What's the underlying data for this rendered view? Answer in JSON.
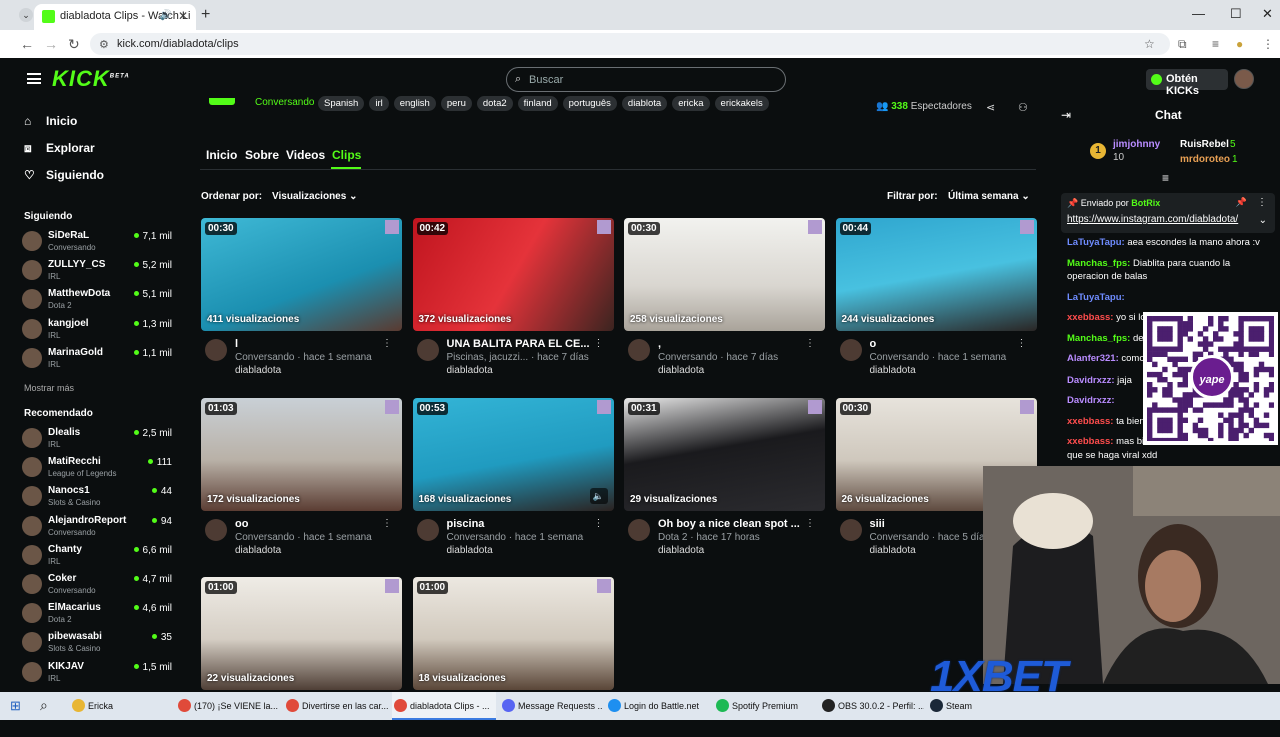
{
  "browser": {
    "tab_title": "diabladota Clips - Watch Li",
    "url": "kick.com/diabladota/clips"
  },
  "header": {
    "search_placeholder": "Buscar",
    "kicks_button": "Obtén KICKs"
  },
  "sidebar": {
    "nav": [
      {
        "label": "Inicio",
        "icon": "home-icon"
      },
      {
        "label": "Explorar",
        "icon": "compass-icon"
      },
      {
        "label": "Siguiendo",
        "icon": "heart-icon"
      }
    ],
    "following_title": "Siguiendo",
    "following": [
      {
        "name": "SiDeRaL",
        "category": "Conversando",
        "viewers": "7,1 mil"
      },
      {
        "name": "ZULLYY_CS",
        "category": "IRL",
        "viewers": "5,2 mil"
      },
      {
        "name": "MatthewDota",
        "category": "Dota 2",
        "viewers": "5,1 mil"
      },
      {
        "name": "kangjoel",
        "category": "IRL",
        "viewers": "1,3 mil"
      },
      {
        "name": "MarinaGold",
        "category": "IRL",
        "viewers": "1,1 mil"
      }
    ],
    "show_more": "Mostrar más",
    "recommended_title": "Recomendado",
    "recommended": [
      {
        "name": "Dlealis",
        "category": "IRL",
        "viewers": "2,5 mil"
      },
      {
        "name": "MatiRecchi",
        "category": "League of Legends",
        "viewers": "111"
      },
      {
        "name": "Nanocs1",
        "category": "Slots & Casino",
        "viewers": "44"
      },
      {
        "name": "AlejandroReport",
        "category": "Conversando",
        "viewers": "94"
      },
      {
        "name": "Chanty",
        "category": "IRL",
        "viewers": "6,6 mil"
      },
      {
        "name": "Coker",
        "category": "Conversando",
        "viewers": "4,7 mil"
      },
      {
        "name": "ElMacarius",
        "category": "Dota 2",
        "viewers": "4,6 mil"
      },
      {
        "name": "pibewasabi",
        "category": "Slots & Casino",
        "viewers": "35"
      },
      {
        "name": "KIKJAV",
        "category": "IRL",
        "viewers": "1,5 mil"
      }
    ]
  },
  "channel": {
    "category": "Conversando",
    "tags": [
      "Spanish",
      "irl",
      "english",
      "peru",
      "dota2",
      "finland",
      "português",
      "diablota",
      "ericka",
      "erickakels"
    ],
    "viewers_count": "338",
    "viewers_label": "Espectadores",
    "tabs": [
      "Inicio",
      "Sobre",
      "Videos",
      "Clips"
    ],
    "order_label": "Ordenar por:",
    "order_value": "Visualizaciones",
    "filter_label": "Filtrar por:",
    "filter_value": "Última semana"
  },
  "clips": [
    {
      "duration": "00:30",
      "views": "411 visualizaciones",
      "title": "l",
      "meta": "Conversando · hace 1 semana",
      "author": "diabladota"
    },
    {
      "duration": "00:42",
      "views": "372 visualizaciones",
      "title": "UNA BALITA PARA EL CE...",
      "meta": "Piscinas, jacuzzi... · hace 7 días",
      "author": "diabladota"
    },
    {
      "duration": "00:30",
      "views": "258 visualizaciones",
      "title": ",",
      "meta": "Conversando · hace 7 días",
      "author": "diabladota"
    },
    {
      "duration": "00:44",
      "views": "244 visualizaciones",
      "title": "o",
      "meta": "Conversando · hace 1 semana",
      "author": "diabladota"
    },
    {
      "duration": "01:03",
      "views": "172 visualizaciones",
      "title": "oo",
      "meta": "Conversando · hace 1 semana",
      "author": "diabladota"
    },
    {
      "duration": "00:53",
      "views": "168 visualizaciones",
      "title": "piscina",
      "meta": "Conversando · hace 1 semana",
      "author": "diabladota"
    },
    {
      "duration": "00:31",
      "views": "29 visualizaciones",
      "title": "Oh boy a nice clean spot ...",
      "meta": "Dota 2 · hace 17 horas",
      "author": "diabladota"
    },
    {
      "duration": "00:30",
      "views": "26 visualizaciones",
      "title": "siii",
      "meta": "Conversando · hace 5 días",
      "author": "diabladota"
    },
    {
      "duration": "01:00",
      "views": "22 visualizaciones",
      "title": "",
      "meta": "",
      "author": ""
    },
    {
      "duration": "01:00",
      "views": "18 visualizaciones",
      "title": "",
      "meta": "",
      "author": ""
    }
  ],
  "chat": {
    "title": "Chat",
    "leaderboard": [
      {
        "name": "jimjohnny",
        "value": "10"
      },
      {
        "name": "RuisRebel",
        "value": "5"
      },
      {
        "name": "mrdoroteo",
        "value": "1"
      }
    ],
    "pinned_by_label": "Enviado por",
    "pinned_by_user": "BotRix",
    "pinned_link": "https://www.instagram.com/diabladota/",
    "messages": [
      {
        "user": "LaTuyaTapu:",
        "text": " aea escondes la mano ahora :v",
        "color": "#6f8cff"
      },
      {
        "user": "Manchas_fps:",
        "text": " Diablita para cuando la",
        "color": "#53fc18"
      },
      {
        "user": "",
        "text": "operacion de balas",
        "color": "#fff"
      },
      {
        "user": "LaTuyaTapu:",
        "text": "",
        "color": "#6f8cff"
      },
      {
        "user": "xxebbass:",
        "text": " yo si lo",
        "color": "#ff4d4d"
      },
      {
        "user": "Manchas_fps:",
        "text": " de",
        "color": "#53fc18"
      },
      {
        "user": "Alanfer321:",
        "text": " como",
        "color": "#b98cff"
      },
      {
        "user": "Davidrxzz:",
        "text": " jaja",
        "color": "#b98cff"
      },
      {
        "user": "Davidrxzz:",
        "text": "",
        "color": "#b98cff"
      },
      {
        "user": "xxebbass:",
        "text": " ta bien",
        "color": "#ff4d4d"
      },
      {
        "user": "xxebbass:",
        "text": " mas bi",
        "color": "#ff4d4d"
      }
    ],
    "trailing_text": "que se haga viral xdd",
    "qr_brand": "yape"
  },
  "overlay_brand": "1XBET",
  "taskbar": [
    {
      "label": "Ericka",
      "color": "#e8b634"
    },
    {
      "label": "(170) ¡Se VIENE la...",
      "color": "#e04a3a"
    },
    {
      "label": "Divertirse en las car...",
      "color": "#e04a3a"
    },
    {
      "label": "diabladota Clips - ...",
      "color": "#e04a3a"
    },
    {
      "label": "Message Requests ...",
      "color": "#5865f2"
    },
    {
      "label": "Login do Battle.net",
      "color": "#1e8ff0"
    },
    {
      "label": "Spotify Premium",
      "color": "#1db954"
    },
    {
      "label": "OBS 30.0.2 - Perfil: ...",
      "color": "#222"
    },
    {
      "label": "Steam",
      "color": "#1b2838"
    }
  ]
}
